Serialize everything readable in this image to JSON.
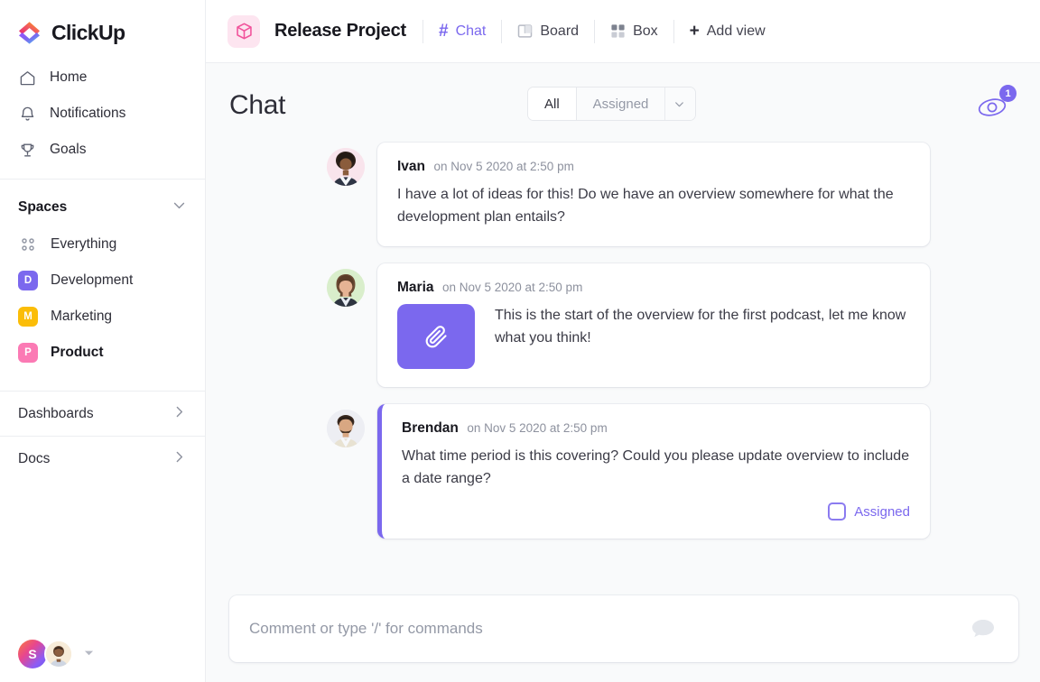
{
  "brand": {
    "name": "ClickUp",
    "logo_icon": "clickup-logo-icon",
    "accent_purple": "#7b68ee",
    "accent_pink": "#ff4f9a"
  },
  "sidebar": {
    "nav": [
      {
        "label": "Home",
        "icon": "home-icon"
      },
      {
        "label": "Notifications",
        "icon": "bell-icon"
      },
      {
        "label": "Goals",
        "icon": "trophy-icon"
      }
    ],
    "spaces_section": {
      "title": "Spaces",
      "collapse_icon": "chevron-down-icon",
      "items": [
        {
          "label": "Everything",
          "icon": "dots-grid-icon",
          "badge": null,
          "color": null,
          "active": false
        },
        {
          "label": "Development",
          "icon": null,
          "badge": "D",
          "color": "#7b68ee",
          "active": false
        },
        {
          "label": "Marketing",
          "icon": null,
          "badge": "M",
          "color": "#fbbd08",
          "active": false
        },
        {
          "label": "Product",
          "icon": null,
          "badge": "P",
          "color": "#fb7ab4",
          "active": true
        }
      ]
    },
    "footer_items": [
      {
        "label": "Dashboards",
        "icon": "chevron-right-icon"
      },
      {
        "label": "Docs",
        "icon": "chevron-right-icon"
      }
    ],
    "user_bar": {
      "workspace_initial": "S",
      "workspace_icon": "workspace-avatar",
      "user_avatar_icon": "user-avatar",
      "caret_icon": "caret-down-icon"
    }
  },
  "topbar": {
    "project_icon": "cube-icon",
    "project_title": "Release Project",
    "tabs": [
      {
        "label": "Chat",
        "icon": "hash-icon",
        "active": true
      },
      {
        "label": "Board",
        "icon": "board-icon",
        "active": false
      },
      {
        "label": "Box",
        "icon": "box-grid-icon",
        "active": false
      }
    ],
    "add_view": {
      "label": "Add view",
      "icon": "plus-icon"
    }
  },
  "chat": {
    "title": "Chat",
    "filter": {
      "all_label": "All",
      "assigned_label": "Assigned",
      "caret_icon": "chevron-down-icon",
      "selected": "All"
    },
    "watchers": {
      "icon": "eye-icon",
      "count": "1"
    },
    "messages": [
      {
        "author": "Ivan",
        "time": "on Nov 5 2020 at 2:50 pm",
        "text": "I have a lot of ideas for this! Do we have an overview somewhere for what the development plan entails?",
        "avatar_icon": "avatar-ivan",
        "avatar_bg": "#f9e4ec",
        "has_attachment": false,
        "accent": false,
        "assigned": null
      },
      {
        "author": "Maria",
        "time": "on Nov 5 2020 at 2:50 pm",
        "text": "This is the start of the overview for the first podcast, let me know what you think!",
        "avatar_icon": "avatar-maria",
        "avatar_bg": "#dff0d8",
        "has_attachment": true,
        "attachment_icon": "paperclip-icon",
        "accent": false,
        "assigned": null
      },
      {
        "author": "Brendan",
        "time": "on Nov 5 2020 at 2:50 pm",
        "text": "What time period is this covering? Could you please update overview to include a date range?",
        "avatar_icon": "avatar-brendan",
        "avatar_bg": "#e9ebf2",
        "has_attachment": false,
        "accent": true,
        "assigned": {
          "label": "Assigned",
          "checked": false
        }
      }
    ],
    "composer": {
      "placeholder": "Comment or type '/' for commands",
      "value": "",
      "icon": "comment-bubble-icon"
    }
  }
}
